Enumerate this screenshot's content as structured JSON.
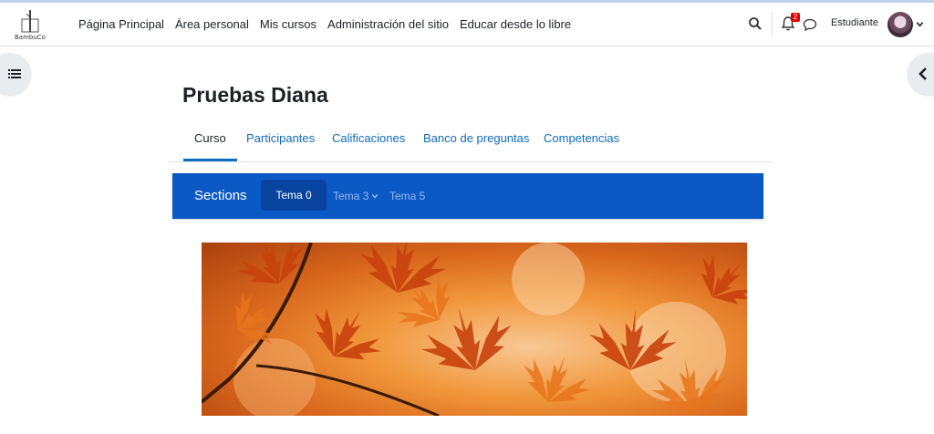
{
  "logo": {
    "text": "BambuCo"
  },
  "nav": {
    "items": [
      "Página Principal",
      "Área personal",
      "Mis cursos",
      "Administración del sitio",
      "Educar desde lo libre"
    ]
  },
  "user": {
    "name": "Estudiante",
    "notifications": "2"
  },
  "course": {
    "title": "Pruebas Diana"
  },
  "tabs": [
    {
      "label": "Curso",
      "active": true
    },
    {
      "label": "Participantes"
    },
    {
      "label": "Calificaciones"
    },
    {
      "label": "Banco de preguntas"
    },
    {
      "label": "Competencias"
    }
  ],
  "sections": {
    "title": "Sections",
    "items": [
      {
        "label": "Tema 0",
        "active": true
      },
      {
        "label": "Tema 3",
        "dropdown": true
      },
      {
        "label": "Tema 5"
      }
    ]
  },
  "icons": {
    "search": "search-icon",
    "bell": "bell-icon",
    "chat": "chat-icon",
    "drawer_left": "list-icon",
    "drawer_right": "chevron-left-icon"
  },
  "colors": {
    "primary": "#0f6cbf",
    "sections_bar": "#0b59c5",
    "sections_pill": "#0843a0",
    "badge": "#e40000"
  }
}
